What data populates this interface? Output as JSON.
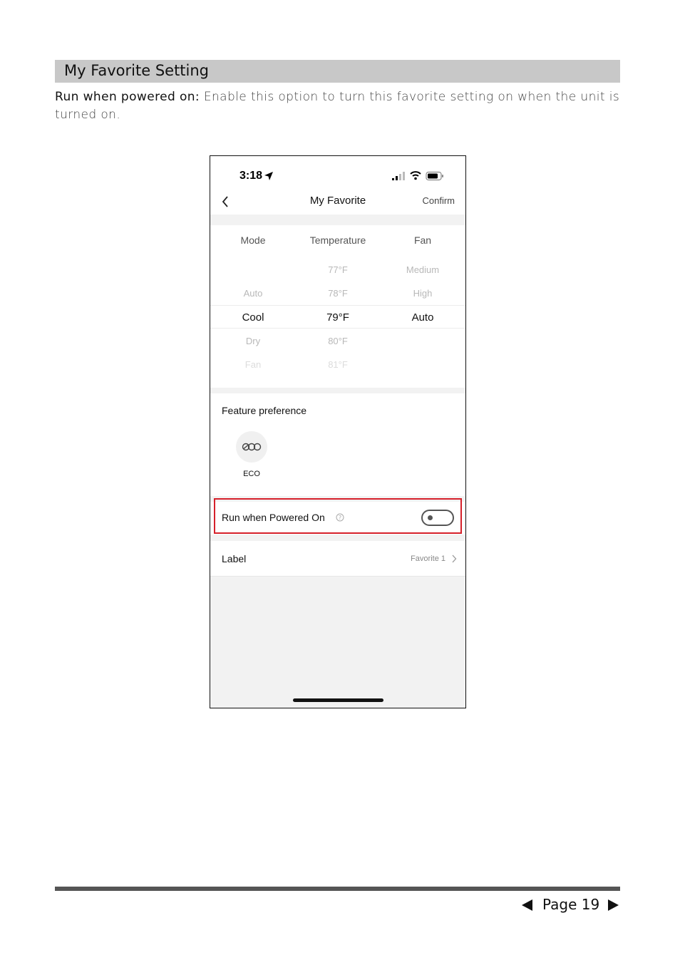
{
  "section": {
    "title": "My Favorite Setting"
  },
  "intro": {
    "term": "Run when powered on:",
    "text": " Enable this option to turn this favorite setting on when the unit is turned on."
  },
  "phone": {
    "status": {
      "time": "3:18"
    },
    "nav": {
      "title": "My Favorite",
      "confirm": "Confirm"
    },
    "picker": {
      "headers": [
        "Mode",
        "Temperature",
        "Fan"
      ],
      "rows": [
        [
          "",
          "77°F",
          "Medium"
        ],
        [
          "Auto",
          "78°F",
          "High"
        ],
        [
          "Cool",
          "79°F",
          "Auto"
        ],
        [
          "Dry",
          "80°F",
          ""
        ],
        [
          "Fan",
          "81°F",
          ""
        ]
      ]
    },
    "feature": {
      "title": "Feature preference",
      "eco_label": "ECO",
      "eco_icon": "eco-icon"
    },
    "run_powered_on": {
      "label": "Run when Powered On",
      "enabled": false
    },
    "label_row": {
      "name": "Label",
      "value": "Favorite 1"
    },
    "highlight_color": "#d6202a"
  },
  "footer": {
    "page": "Page 19"
  }
}
